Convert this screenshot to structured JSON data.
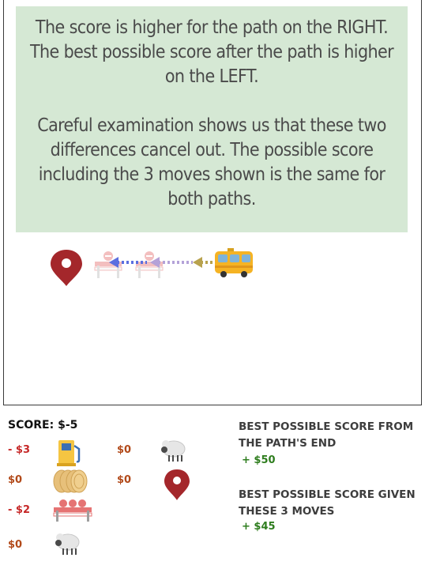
{
  "message": {
    "paragraph1": "The score is higher for the path on the RIGHT. The best possible score after the path is higher on the LEFT.",
    "paragraph2": "Careful examination shows us that these two differences cancel out. The possible score including the 3 moves shown is the same for both paths."
  },
  "hud": {
    "score_label": "SCORE:",
    "score_value": "$-5",
    "items": [
      {
        "cost": "- $3",
        "icon": "fuel-pump-icon"
      },
      {
        "cost": "$0",
        "icon": "sheep-icon"
      },
      {
        "cost": "$0",
        "icon": "coins-icon"
      },
      {
        "cost": "$0",
        "icon": "destination-pin-icon"
      },
      {
        "cost": "- $2",
        "icon": "roadblock-icon"
      },
      {
        "cost": "$0",
        "icon": "sheep-icon"
      }
    ],
    "best_from_end_label": "BEST POSSIBLE SCORE FROM THE PATH'S END",
    "best_from_end_value": "+ $50",
    "best_given_moves_label": "BEST POSSIBLE SCORE GIVEN THESE 3 MOVES",
    "best_given_moves_value": "+ $45"
  },
  "colors": {
    "message_bg": "#d5e8d4",
    "negative": "#c62828",
    "positive": "#2e7d1e",
    "pin": "#a4272b",
    "bus": "#f5b324"
  }
}
